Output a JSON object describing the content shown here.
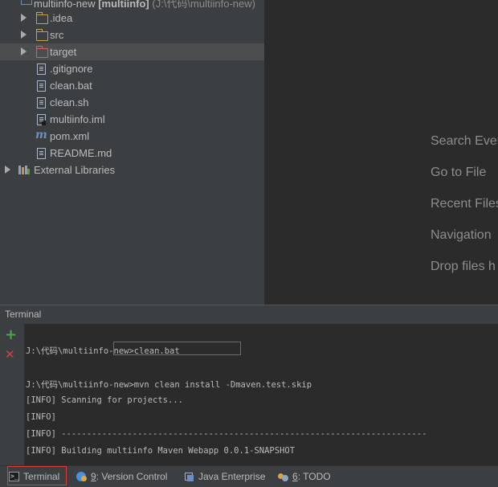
{
  "project": {
    "root_name": "multiinfo-new",
    "root_module": "[multiinfo]",
    "root_path": "(J:\\代码\\multiinfo-new)",
    "items": [
      {
        "label": ".idea",
        "type": "folder",
        "expandable": true
      },
      {
        "label": "src",
        "type": "folder",
        "expandable": true
      },
      {
        "label": "target",
        "type": "folder-excluded",
        "expandable": true,
        "selected": true
      },
      {
        "label": ".gitignore",
        "type": "file"
      },
      {
        "label": "clean.bat",
        "type": "file"
      },
      {
        "label": "clean.sh",
        "type": "file"
      },
      {
        "label": "multiinfo.iml",
        "type": "iml"
      },
      {
        "label": "pom.xml",
        "type": "maven"
      },
      {
        "label": "README.md",
        "type": "file"
      }
    ],
    "external_libraries": "External Libraries"
  },
  "welcome": {
    "items": [
      "Search Every",
      "Go to File",
      "Recent Files",
      "Navigation",
      "Drop files h"
    ]
  },
  "terminal": {
    "title": "Terminal",
    "lines": [
      "J:\\代码\\multiinfo-new>clean.bat",
      "",
      "J:\\代码\\multiinfo-new>mvn clean install -Dmaven.test.skip",
      "[INFO] Scanning for projects...",
      "[INFO]",
      "[INFO] ------------------------------------------------------------------------",
      "[INFO] Building multiinfo Maven Webapp 0.0.1-SNAPSHOT"
    ],
    "add_symbol": "+",
    "close_symbol": "✕"
  },
  "toolbar": {
    "terminal": "Terminal",
    "vcs_number": "9",
    "vcs_label": ": Version Control",
    "java_ee": "Java Enterprise",
    "todo_number": "6",
    "todo_label": ": TODO"
  },
  "colors": {
    "panel_bg": "#3c3f41",
    "editor_bg": "#2b2b2b",
    "folder": "#c7a24b",
    "excluded_folder": "#d95f5f",
    "highlight_red": "#e23a3a",
    "add_green": "#4fa54f"
  }
}
